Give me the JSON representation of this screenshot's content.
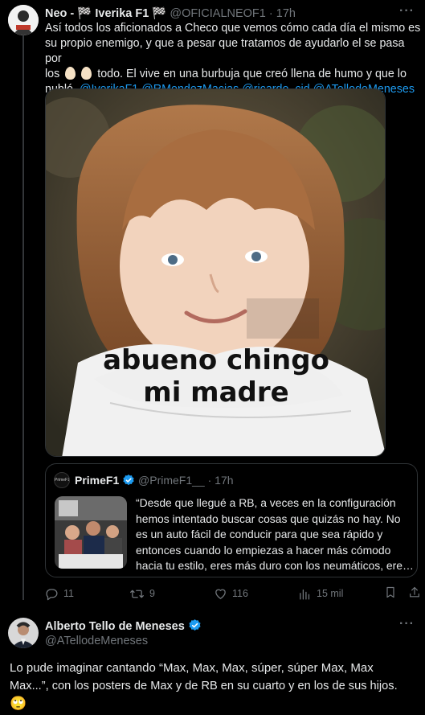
{
  "tweet1": {
    "name": "Neo - 🏁 Iverika F1 🏁",
    "handle": "@OFICIALNEOF1",
    "time": "17h",
    "text_line1": "Así todos los aficionados a Checo que vemos cómo cada día el mismo es",
    "text_line2": "su propio enemigo, y que a pesar que tratamos de ayudarlo el se pasa por",
    "text_line3_pre": "los",
    "text_line3_post": "todo. El vive en una burbuja que creó llena de humo y que lo",
    "text_line4": "nubló.",
    "mentions": [
      "@IverikaF1",
      "@RMendezMacias",
      "@ricardo_cid",
      "@ATellodeMeneses"
    ],
    "meme_caption_line1": "abueno chingo",
    "meme_caption_line2": "mi madre",
    "actions": {
      "replies": "11",
      "retweets": "9",
      "likes": "116",
      "views": "15 mil"
    }
  },
  "quote": {
    "name": "PrimeF1",
    "handle": "@PrimeF1__",
    "time": "17h",
    "line1": "“Desde que llegué a RB, a veces en la configuración",
    "line2": "hemos intentado buscar cosas que quizás no hay. No",
    "line3": "es un auto fácil de conducir para que sea rápido y",
    "line4": "entonces cuando lo empiezas a hacer más cómodo",
    "line5": "hacia tu estilo, eres más duro con los neumáticos, ere…",
    "avatar_label": "PrimeF1"
  },
  "tweet2": {
    "name": "Alberto Tello de Meneses",
    "handle": "@ATellodeMeneses",
    "line1": "Lo pude imaginar cantando “Max, Max, Max, súper, súper Max, Max",
    "line2": "Max...”, con los posters de Max y de RB en su cuarto y en los de sus hijos.",
    "emoji": "🙄"
  },
  "colors": {
    "background": "#000000",
    "text": "#e7e9ea",
    "muted": "#71767b",
    "link": "#1d9bf0",
    "border": "#2f3336",
    "verified": "#1d9bf0"
  }
}
